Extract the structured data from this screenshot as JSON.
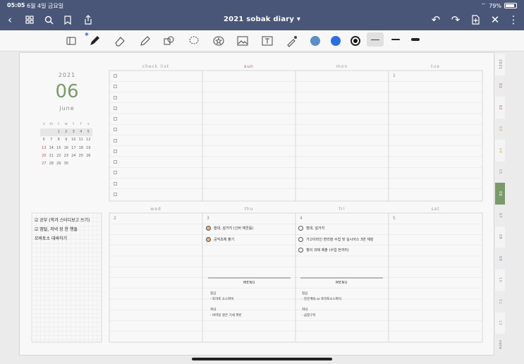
{
  "status": {
    "time": "05:05",
    "date": "6월 4일 금요일",
    "battery": "79%"
  },
  "nav": {
    "title": "2021 sobak diary",
    "title_chevron": "▾"
  },
  "toolbar": {
    "colors": {
      "color1": "#5b8ec4",
      "color2": "#2a6fe0",
      "color3": "#111111"
    },
    "thickness": [
      "thin",
      "medium",
      "thick"
    ]
  },
  "planner": {
    "year": "2021",
    "month_num": "06",
    "month_name": "june",
    "mini_cal": {
      "headers": [
        "s",
        "m",
        "t",
        "w",
        "t",
        "f",
        "s"
      ],
      "weeks": [
        [
          "",
          "",
          "1",
          "2",
          "3",
          "4",
          "5"
        ],
        [
          "6",
          "7",
          "8",
          "9",
          "10",
          "11",
          "12"
        ],
        [
          "13",
          "14",
          "15",
          "16",
          "17",
          "18",
          "19"
        ],
        [
          "20",
          "21",
          "22",
          "23",
          "24",
          "25",
          "26"
        ],
        [
          "27",
          "28",
          "29",
          "30",
          "",
          "",
          ""
        ]
      ]
    },
    "top_headers": {
      "checklist": "check list",
      "sun": "sun",
      "mon": "mon",
      "tue": "tue"
    },
    "bottom_headers": {
      "wed": "wed",
      "thu": "thu",
      "fri": "fri",
      "sat": "sat"
    },
    "day_nums": {
      "tue": "1",
      "wed": "2",
      "thu": "3",
      "fri": "4",
      "sat": "5"
    },
    "notes": [
      "☑ 공부 (학과 스터디보고 쓰기)",
      "☑ 앱털, 저녁 장 한 행돌",
      "  모바토소 대바하기"
    ],
    "thu_tasks": [
      {
        "text": "행대, 설거지 (신버 깨끗음)",
        "done": true
      },
      {
        "text": "공씩초체 풀기",
        "done": true
      }
    ],
    "fri_tasks": [
      {
        "text": "행대, 설거지",
        "done": false
      },
      {
        "text": "가고이러인 변리점 수업 및 실시아스 3번 재킹",
        "done": false
      },
      {
        "text": "챙의 과제 제출 (수업 전까지)",
        "done": false
      }
    ],
    "thu_menu": {
      "title": "MENU",
      "lunch_label": "점심",
      "lunch": "- 토마토 소스파이",
      "dinner_label": "저녁",
      "dinner": "- 바라탕 살은 기세 파빈"
    },
    "fri_menu": {
      "title": "MENU",
      "lunch_label": "점심",
      "lunch": "- 진은계육 or 토마토소스파이",
      "dinner_label": "저녁",
      "dinner": "- 곱창구이"
    }
  },
  "tabs": [
    {
      "label": "2021",
      "color": "#777"
    },
    {
      "label": "01",
      "color": "#c0504d"
    },
    {
      "label": "02",
      "color": "#c0504d"
    },
    {
      "label": "03",
      "color": "#d8925a"
    },
    {
      "label": "04",
      "color": "#d8b24a"
    },
    {
      "label": "05",
      "color": "#999"
    },
    {
      "label": "06",
      "color": "#ffffff"
    },
    {
      "label": "07",
      "color": "#6a8fb3"
    },
    {
      "label": "08",
      "color": "#6a8fb3"
    },
    {
      "label": "09",
      "color": "#6a8fb3"
    },
    {
      "label": "10",
      "color": "#999"
    },
    {
      "label": "11",
      "color": "#999"
    },
    {
      "label": "12",
      "color": "#999"
    },
    {
      "label": "note",
      "color": "#777"
    }
  ]
}
